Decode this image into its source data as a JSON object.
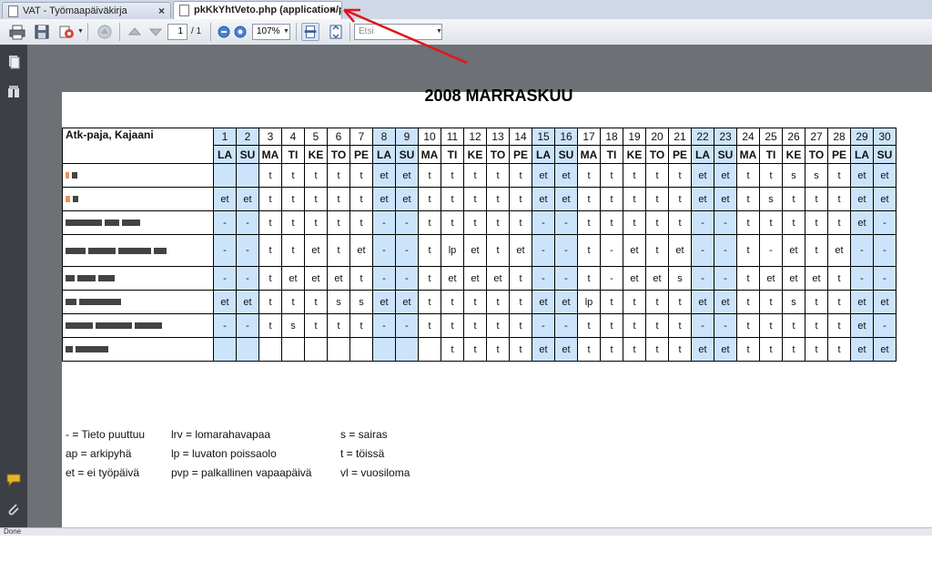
{
  "tabs": [
    {
      "title": "VAT - Työmaapäiväkirja",
      "close": "×",
      "active": false
    },
    {
      "title": "pkKkYhtVeto.php (application/pd...",
      "close": "×",
      "active": true
    }
  ],
  "toolbar": {
    "page_current": "1",
    "page_total": "/ 1",
    "zoom": "107%",
    "search_placeholder": "Etsi",
    "icons": [
      "print-icon",
      "save-icon",
      "export-icon",
      "hand-tool-icon",
      "page-up-icon",
      "page-down-icon",
      "zoom-out-icon",
      "zoom-in-icon",
      "fit-width-icon",
      "fit-page-icon"
    ]
  },
  "status_text": "Done",
  "document": {
    "title": "2008 MARRASKUU",
    "location": "Atk-paja, Kajaani",
    "day_numbers": [
      "1",
      "2",
      "3",
      "4",
      "5",
      "6",
      "7",
      "8",
      "9",
      "10",
      "11",
      "12",
      "13",
      "14",
      "15",
      "16",
      "17",
      "18",
      "19",
      "20",
      "21",
      "22",
      "23",
      "24",
      "25",
      "26",
      "27",
      "28",
      "29",
      "30"
    ],
    "day_names": [
      "LA",
      "SU",
      "MA",
      "TI",
      "KE",
      "TO",
      "PE",
      "LA",
      "SU",
      "MA",
      "TI",
      "KE",
      "TO",
      "PE",
      "LA",
      "SU",
      "MA",
      "TI",
      "KE",
      "TO",
      "PE",
      "LA",
      "SU",
      "MA",
      "TI",
      "KE",
      "TO",
      "PE",
      "LA",
      "SU"
    ],
    "weekend_days": [
      1,
      2,
      8,
      9,
      15,
      16,
      22,
      23,
      29,
      30
    ],
    "rows": [
      [
        "",
        "",
        "t",
        "t",
        "t",
        "t",
        "t",
        "et",
        "et",
        "t",
        "t",
        "t",
        "t",
        "t",
        "et",
        "et",
        "t",
        "t",
        "t",
        "t",
        "t",
        "et",
        "et",
        "t",
        "t",
        "s",
        "s",
        "t",
        "et",
        "et"
      ],
      [
        "et",
        "et",
        "t",
        "t",
        "t",
        "t",
        "t",
        "et",
        "et",
        "t",
        "t",
        "t",
        "t",
        "t",
        "et",
        "et",
        "t",
        "t",
        "t",
        "t",
        "t",
        "et",
        "et",
        "t",
        "s",
        "t",
        "t",
        "t",
        "et",
        "et"
      ],
      [
        "-",
        "-",
        "t",
        "t",
        "t",
        "t",
        "t",
        "-",
        "-",
        "t",
        "t",
        "t",
        "t",
        "t",
        "-",
        "-",
        "t",
        "t",
        "t",
        "t",
        "t",
        "-",
        "-",
        "t",
        "t",
        "t",
        "t",
        "t",
        "et",
        "-"
      ],
      [
        "-",
        "-",
        "t",
        "t",
        "et",
        "t",
        "et",
        "-",
        "-",
        "t",
        "lp",
        "et",
        "t",
        "et",
        "-",
        "-",
        "t",
        "-",
        "et",
        "t",
        "et",
        "-",
        "-",
        "t",
        "-",
        "et",
        "t",
        "et",
        "-",
        "-"
      ],
      [
        "-",
        "-",
        "t",
        "et",
        "et",
        "et",
        "t",
        "-",
        "-",
        "t",
        "et",
        "et",
        "et",
        "t",
        "-",
        "-",
        "t",
        "-",
        "et",
        "et",
        "s",
        "-",
        "-",
        "t",
        "et",
        "et",
        "et",
        "t",
        "-",
        "-"
      ],
      [
        "et",
        "et",
        "t",
        "t",
        "t",
        "s",
        "s",
        "et",
        "et",
        "t",
        "t",
        "t",
        "t",
        "t",
        "et",
        "et",
        "lp",
        "t",
        "t",
        "t",
        "t",
        "et",
        "et",
        "t",
        "t",
        "s",
        "t",
        "t",
        "et",
        "et"
      ],
      [
        "-",
        "-",
        "t",
        "s",
        "t",
        "t",
        "t",
        "-",
        "-",
        "t",
        "t",
        "t",
        "t",
        "t",
        "-",
        "-",
        "t",
        "t",
        "t",
        "t",
        "t",
        "-",
        "-",
        "t",
        "t",
        "t",
        "t",
        "t",
        "et",
        "-"
      ],
      [
        "",
        "",
        "",
        "",
        "",
        "",
        "",
        "",
        "",
        "",
        "t",
        "t",
        "t",
        "t",
        "et",
        "et",
        "t",
        "t",
        "t",
        "t",
        "t",
        "et",
        "et",
        "t",
        "t",
        "t",
        "t",
        "t",
        "et",
        "et"
      ]
    ],
    "legend": [
      [
        "- = Tieto puuttuu",
        "ap = arkipyhä",
        "et = ei työpäivä"
      ],
      [
        "lrv = lomarahavapaa",
        "lp = luvaton poissaolo",
        "pvp = palkallinen vapaapäivä"
      ],
      [
        "s = sairas",
        "t = töissä",
        "vl = vuosiloma"
      ]
    ]
  },
  "colors": {
    "weekend_fill": "#cce4fb",
    "annotation_arrow": "#e0161b",
    "left_panel": "#3c3f44",
    "doc_background": "#6d7075"
  }
}
